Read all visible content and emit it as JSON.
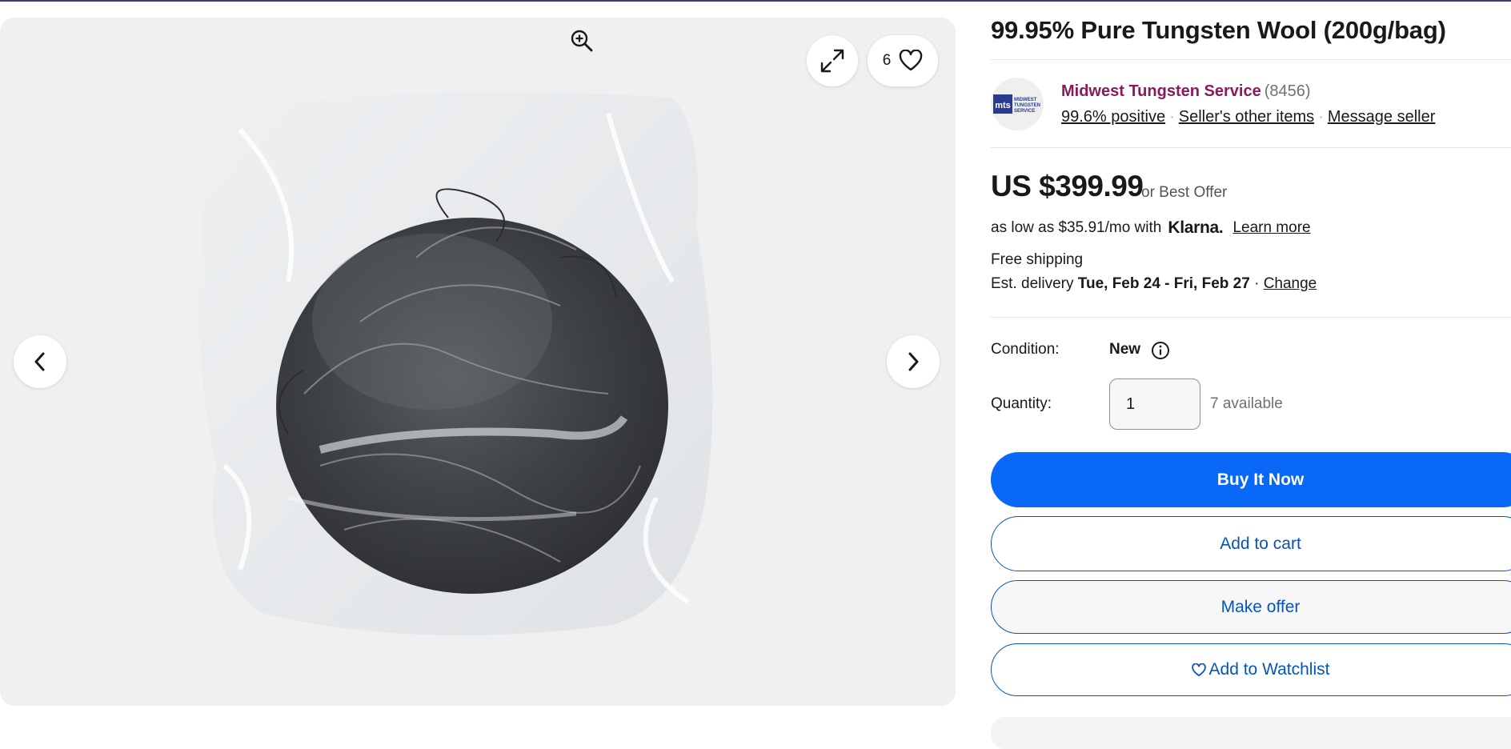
{
  "gallery": {
    "image_alt": "Tungsten wool in clear plastic bag",
    "watch_count": "6",
    "icons": {
      "zoom": "zoom-in-icon",
      "expand": "expand-icon",
      "heart": "heart-icon",
      "prev": "chevron-left-icon",
      "next": "chevron-right-icon"
    }
  },
  "listing": {
    "title": "99.95% Pure Tungsten Wool (200g/bag)"
  },
  "seller": {
    "name": "Midwest Tungsten Service",
    "feedback_count": "(8456)",
    "positive": "99.6% positive",
    "other_items": "Seller's other items",
    "message": "Message seller",
    "logo_text": "mts",
    "logo_caption": "MIDWEST TUNGSTEN SERVICE"
  },
  "price": {
    "amount": "US $399.99",
    "offer_note": "or Best Offer",
    "financing_prefix": "as low as $35.91/mo with",
    "financing_brand": "Klarna.",
    "learn_more": "Learn more"
  },
  "shipping": {
    "label": "Free shipping",
    "est_prefix": "Est. delivery",
    "est_dates": "Tue, Feb 24 - Fri, Feb 27",
    "separator": "·",
    "change": "Change"
  },
  "condition": {
    "label": "Condition:",
    "value": "New"
  },
  "quantity": {
    "label": "Quantity:",
    "value": "1",
    "available": "7 available"
  },
  "actions": {
    "buy_now": "Buy It Now",
    "add_to_cart": "Add to cart",
    "make_offer": "Make offer",
    "watchlist": "Add to Watchlist"
  },
  "colors": {
    "primary_blue": "#0968f6",
    "link_blue": "#0654ba",
    "seller_name": "#8a1a5d",
    "gallery_bg": "#f0f0f0"
  }
}
